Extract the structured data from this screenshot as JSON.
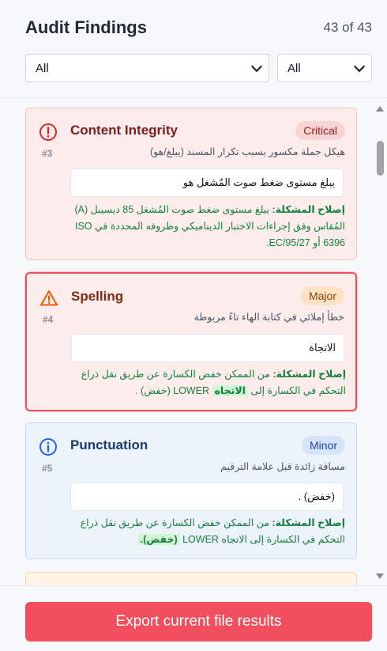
{
  "header": {
    "title": "Audit Findings",
    "count": "43 of 43"
  },
  "filters": [
    {
      "selected": "All"
    },
    {
      "selected": "All"
    }
  ],
  "findings": [
    {
      "number": "#3",
      "category": "Content Integrity",
      "severity": "Critical",
      "icon": "error-circle-icon",
      "description": "هيكل جملة مكسور بسبب تكرار المسند (يبلغ/هو)",
      "snippet": "يبلغ مستوى ضغط صوت المُشغل هو",
      "fix_label": "إصلاح المشكلة:",
      "fix_text": "يبلغ مستوى ضغط صوت المُشغل 85 ديسيبل (A) المُقاس وفق إجراءات الاختبار الديناميكي وظروفه المحددة في ISO 6396 أو EC/95/27."
    },
    {
      "number": "#4",
      "category": "Spelling",
      "severity": "Major",
      "icon": "warning-triangle-icon",
      "description": "خطأ إملائي في كتابة الهاء تاءً مربوطة",
      "snippet": "الاتجاة",
      "fix_label": "إصلاح المشكلة:",
      "fix_text_before": "من الممكن خفض الكسارة عن طريق نقل ذراع التحكم في الكسارة إلى",
      "fix_highlight": "الاتجاه",
      "fix_text_after": "LOWER (خفض) ."
    },
    {
      "number": "#5",
      "category": "Punctuation",
      "severity": "Minor",
      "icon": "info-circle-icon",
      "description": "مسافة زائدة قبل علامة الترقيم",
      "snippet": "(خفض) .",
      "fix_label": "إصلاح المشكلة:",
      "fix_text_before": "من الممكن خفض الكسارة عن طريق نقل ذراع التحكم في الكسارة إلى الاتجاه LOWER",
      "fix_highlight": "(خفض)."
    }
  ],
  "footer": {
    "export_label": "Export current file results"
  },
  "colors": {
    "critical": "#dc2626",
    "major": "#ea580c",
    "minor": "#2563eb",
    "export": "#f14e5e"
  }
}
